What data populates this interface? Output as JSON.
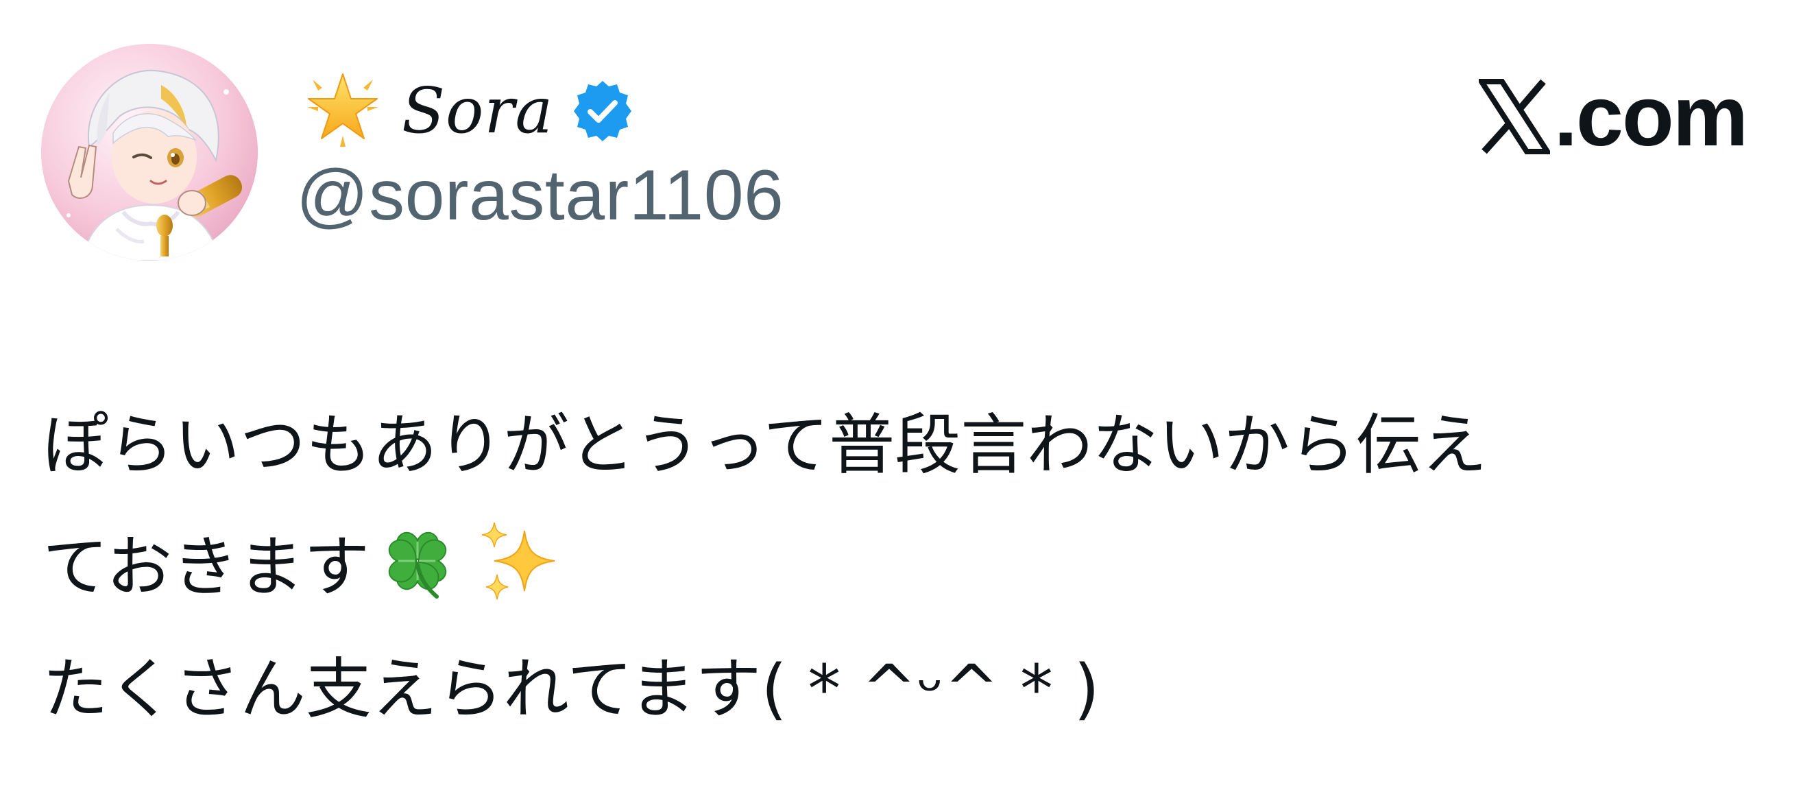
{
  "tweet": {
    "author": {
      "display_name": "Sora",
      "handle": "@sorastar1106",
      "name_prefix_icon": "glowing-star-emoji",
      "verified": true,
      "verified_color": "#1d9bf0"
    },
    "brand": {
      "logo_icon": "x-logo-icon",
      "text": ".com"
    },
    "body": {
      "line1": "ぽらいつもありがとうって普段言わないから伝え",
      "line2": "ておきます",
      "line2_emojis": [
        "four-leaf-clover-emoji",
        "sparkles-emoji"
      ],
      "line3": "たくさん支えられてます( * ^ᵕ^ * )"
    }
  },
  "colors": {
    "text_primary": "#0f1419",
    "text_secondary": "#536471",
    "verified_blue": "#1d9bf0",
    "background": "#ffffff"
  }
}
